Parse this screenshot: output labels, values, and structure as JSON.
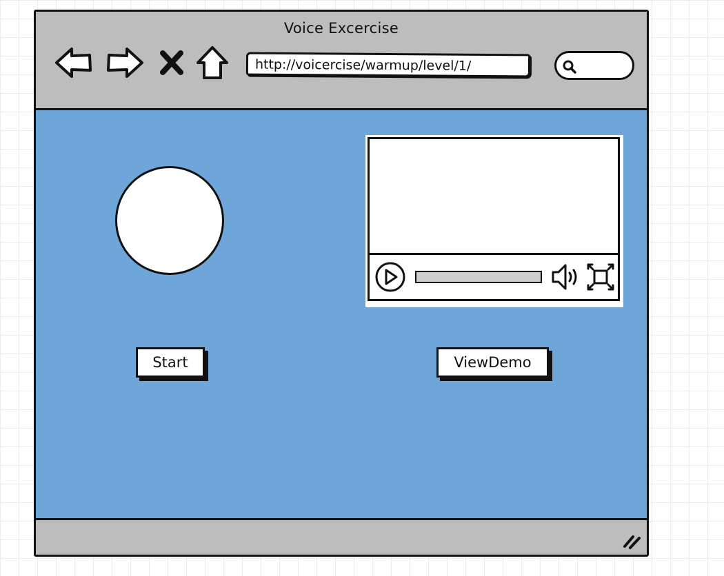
{
  "window": {
    "title": "Voice Excercise"
  },
  "toolbar": {
    "back_icon": "back-arrow-icon",
    "forward_icon": "forward-arrow-icon",
    "stop_icon": "close-x-icon",
    "home_icon": "home-icon",
    "url": "http://voicercise/warmup/level/1/",
    "search_icon": "magnifier-icon",
    "search_value": ""
  },
  "content": {
    "background_color": "#6fa6d9",
    "start_label": "Start",
    "demo_label": "ViewDemo"
  },
  "video": {
    "play_icon": "play-icon",
    "volume_icon": "volume-icon",
    "fullscreen_icon": "fullscreen-icon",
    "progress": 0
  },
  "statusbar": {
    "grip_icon": "resize-grip-icon"
  }
}
